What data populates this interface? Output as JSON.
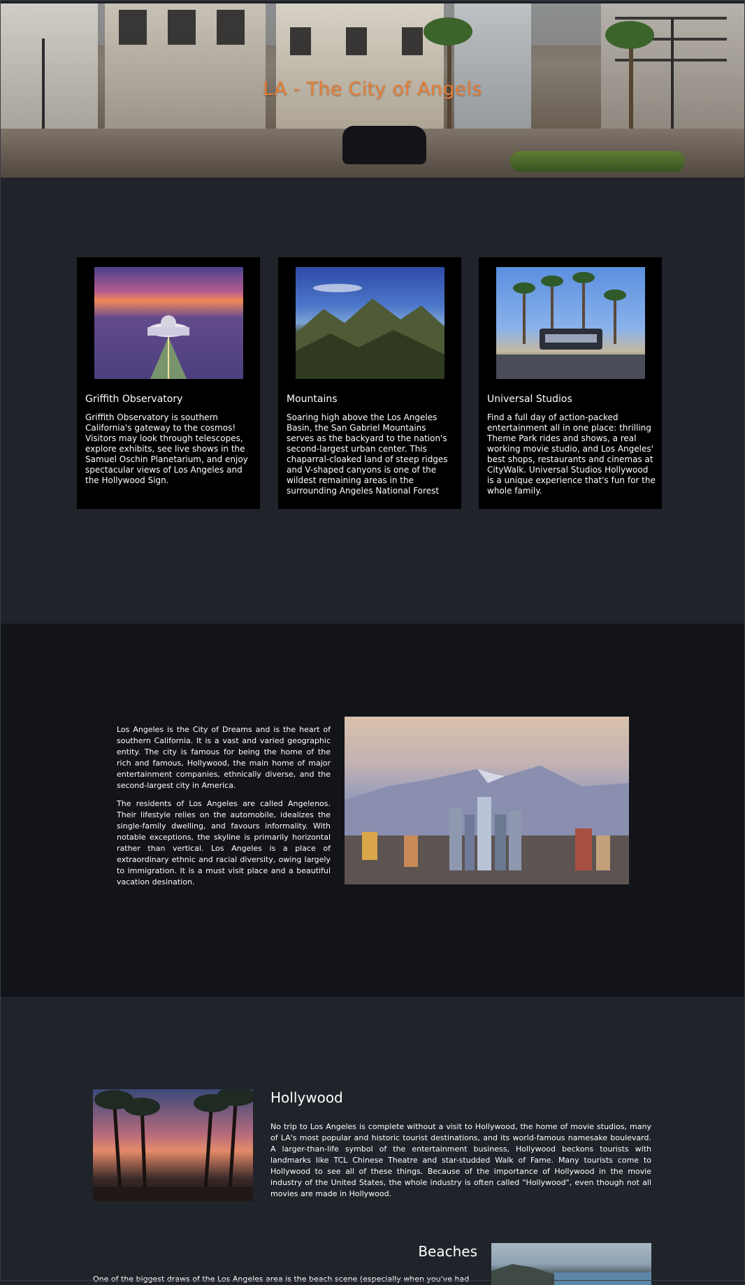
{
  "hero": {
    "title": "LA - The City of Angels"
  },
  "cards": [
    {
      "title": "Griffith Observatory",
      "text": "Griffith Observatory is southern California's gateway to the cosmos! Visitors may look through telescopes, explore exhibits, see live shows in the Samuel Oschin Planetarium, and enjoy spectacular views of Los Angeles and the Hollywood Sign.",
      "image_icon": "observatory-photo"
    },
    {
      "title": "Mountains",
      "text": "Soaring high above the Los Angeles Basin, the San Gabriel Mountains serves as the backyard to the nation's second-largest urban center. This chaparral-cloaked land of steep ridges and V-shaped canyons is one of the wildest remaining areas in the surrounding Angeles National Forest",
      "image_icon": "mountains-photo"
    },
    {
      "title": "Universal Studios",
      "text": "Find a full day of action-packed entertainment all in one place: thrilling Theme Park rides and shows, a real working movie studio, and Los Angeles' best shops, restaurants and cinemas at CityWalk. Universal Studios Hollywood is a unique experience that's fun for the whole family.",
      "image_icon": "universal-studios-photo"
    }
  ],
  "about": {
    "paragraphs": [
      "Los Angeles is the City of Dreams and is the heart of southern California. It is a vast and varied geographic entity. The city is famous for being the home of the rich and famous, Hollywood, the main home of major entertainment companies, ethnically diverse, and the second-largest city in America.",
      "The residents of Los Angeles are called Angelenos. Their lifestyle relies on the automobile, idealizes the single-family dwelling, and favours informality. With notable exceptions, the skyline is primarily horizontal rather than vertical. Los Angeles is a place of extraordinary ethnic and racial diversity, owing largely to immigration. It is a must visit place and a beautiful vacation desination."
    ]
  },
  "hollywood": {
    "title": "Hollywood",
    "text": "No trip to Los Angeles is complete without a visit to Hollywood, the home of movie studios, many of LA's most popular and historic tourist destinations, and its world-famous namesake boulevard. A larger-than-life symbol of the entertainment business, Hollywood beckons tourists with landmarks like TCL Chinese Theatre and star-studded Walk of Fame. Many tourists come to Hollywood to see all of these things. Because of the importance of Hollywood in the movie industry of the United States, the whole industry is often called \"Hollywood\", even though not all movies are made in Hollywood."
  },
  "beaches": {
    "title": "Beaches",
    "text": "One of the biggest draws of the Los Angeles area is the beach scene (especially when you've had"
  }
}
